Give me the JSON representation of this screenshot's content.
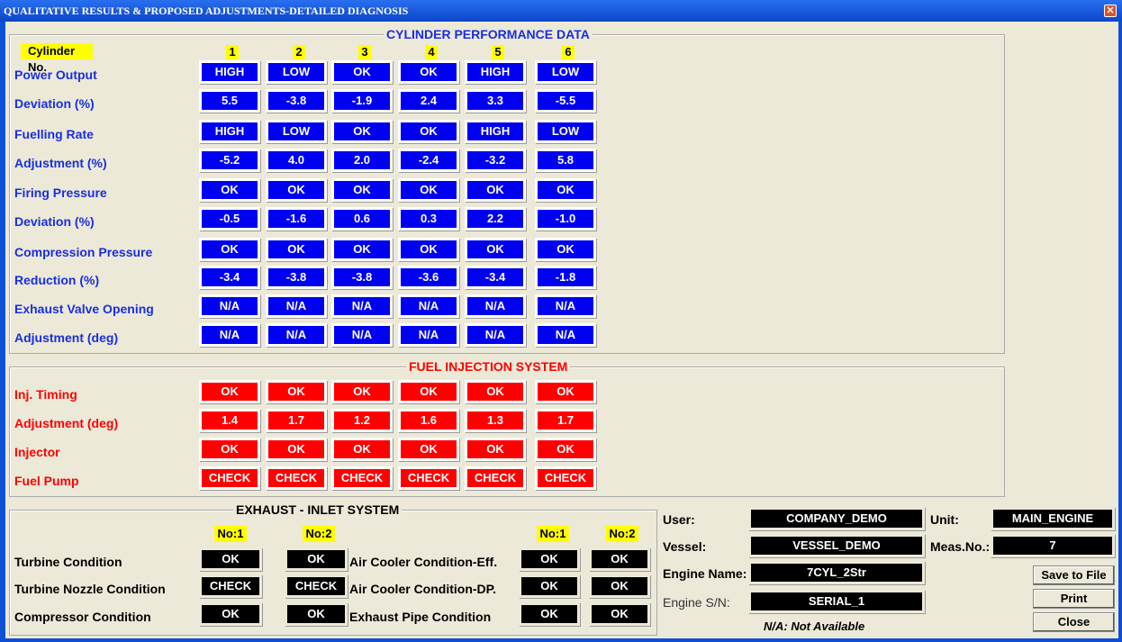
{
  "title": "QUALITATIVE RESULTS & PROPOSED ADJUSTMENTS-DETAILED DIAGNOSIS",
  "close_glyph": "✕",
  "cylinder": {
    "title": "CYLINDER PERFORMANCE DATA",
    "header_label": "Cylinder No.",
    "columns": [
      "1",
      "2",
      "3",
      "4",
      "5",
      "6"
    ],
    "rows": [
      {
        "label": "Power Output",
        "values": [
          "HIGH",
          "LOW",
          "OK",
          "OK",
          "HIGH",
          "LOW"
        ]
      },
      {
        "label": "Deviation (%)",
        "values": [
          "5.5",
          "-3.8",
          "-1.9",
          "2.4",
          "3.3",
          "-5.5"
        ]
      },
      {
        "label": "Fuelling Rate",
        "values": [
          "HIGH",
          "LOW",
          "OK",
          "OK",
          "HIGH",
          "LOW"
        ]
      },
      {
        "label": "Adjustment  (%)",
        "values": [
          "-5.2",
          "4.0",
          "2.0",
          "-2.4",
          "-3.2",
          "5.8"
        ]
      },
      {
        "label": "Firing Pressure",
        "values": [
          "OK",
          "OK",
          "OK",
          "OK",
          "OK",
          "OK"
        ]
      },
      {
        "label": "Deviation (%)",
        "values": [
          "-0.5",
          "-1.6",
          "0.6",
          "0.3",
          "2.2",
          "-1.0"
        ]
      },
      {
        "label": "Compression Pressure",
        "values": [
          "OK",
          "OK",
          "OK",
          "OK",
          "OK",
          "OK"
        ]
      },
      {
        "label": "Reduction (%)",
        "values": [
          "-3.4",
          "-3.8",
          "-3.8",
          "-3.6",
          "-3.4",
          "-1.8"
        ]
      },
      {
        "label": "Exhaust Valve Opening",
        "values": [
          "N/A",
          "N/A",
          "N/A",
          "N/A",
          "N/A",
          "N/A"
        ]
      },
      {
        "label": "Adjustment (deg)",
        "values": [
          "N/A",
          "N/A",
          "N/A",
          "N/A",
          "N/A",
          "N/A"
        ]
      }
    ]
  },
  "fuel": {
    "title": "FUEL INJECTION SYSTEM",
    "rows": [
      {
        "label": "Inj. Timing",
        "values": [
          "OK",
          "OK",
          "OK",
          "OK",
          "OK",
          "OK"
        ]
      },
      {
        "label": "Adjustment (deg)",
        "values": [
          "1.4",
          "1.7",
          "1.2",
          "1.6",
          "1.3",
          "1.7"
        ]
      },
      {
        "label": "Injector",
        "values": [
          "OK",
          "OK",
          "OK",
          "OK",
          "OK",
          "OK"
        ]
      },
      {
        "label": "Fuel Pump",
        "values": [
          "CHECK",
          "CHECK",
          "CHECK",
          "CHECK",
          "CHECK",
          "CHECK"
        ]
      }
    ]
  },
  "exhaust": {
    "title": "EXHAUST - INLET SYSTEM",
    "headers": [
      "No:1",
      "No:2"
    ],
    "left": [
      {
        "label": "Turbine Condition",
        "values": [
          "OK",
          "OK"
        ]
      },
      {
        "label": "Turbine Nozzle Condition",
        "values": [
          "CHECK",
          "CHECK"
        ]
      },
      {
        "label": "Compressor Condition",
        "values": [
          "OK",
          "OK"
        ]
      }
    ],
    "right": [
      {
        "label": "Air Cooler Condition-Eff.",
        "values": [
          "OK",
          "OK"
        ]
      },
      {
        "label": "Air Cooler Condition-DP.",
        "values": [
          "OK",
          "OK"
        ]
      },
      {
        "label": "Exhaust Pipe Condition",
        "values": [
          "OK",
          "OK"
        ]
      }
    ]
  },
  "info": {
    "user_label": "User:",
    "user": "COMPANY_DEMO",
    "unit_label": "Unit:",
    "unit": "MAIN_ENGINE",
    "vessel_label": "Vessel:",
    "vessel": "VESSEL_DEMO",
    "meas_label": "Meas.No.:",
    "meas": "7",
    "engine_label": "Engine Name:",
    "engine": "7CYL_2Str",
    "serial_label": "Engine S/N:",
    "serial": "SERIAL_1",
    "note": "N/A: Not Available"
  },
  "buttons": {
    "save": "Save to File",
    "print": "Print",
    "close": "Close"
  },
  "colors": {
    "blue_label": "#1a2ee0",
    "red_label": "#ff0000",
    "blue_cell": "#0000f0",
    "red_cell": "#ff0000",
    "header": "#ffff00"
  }
}
